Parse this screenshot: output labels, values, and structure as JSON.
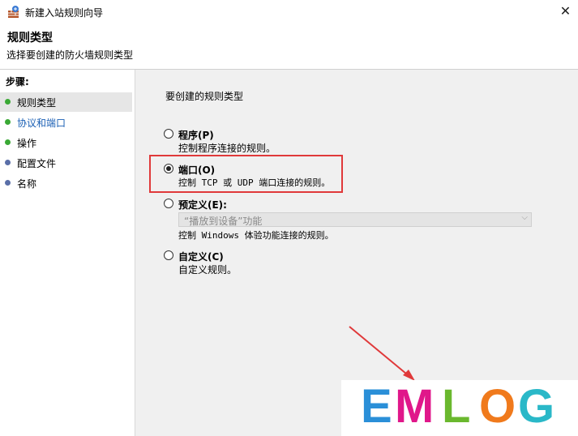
{
  "window": {
    "title": "新建入站规则向导",
    "close_glyph": "✕"
  },
  "header": {
    "title": "规则类型",
    "subtitle": "选择要创建的防火墙规则类型"
  },
  "sidebar": {
    "steps_label": "步骤:",
    "steps": [
      {
        "label": "规则类型",
        "color": "#3aa935",
        "current": true
      },
      {
        "label": "协议和端口",
        "color": "#3aa935",
        "current": false,
        "link_color": "#1a5fb4"
      },
      {
        "label": "操作",
        "color": "#3aa935",
        "current": false
      },
      {
        "label": "配置文件",
        "color": "#5a6fa8",
        "current": false
      },
      {
        "label": "名称",
        "color": "#5a6fa8",
        "current": false
      }
    ]
  },
  "main": {
    "prompt": "要创建的规则类型",
    "options": [
      {
        "label": "程序(P)",
        "desc": "控制程序连接的规则。",
        "checked": false
      },
      {
        "label": "端口(O)",
        "desc": "控制 TCP 或 UDP 端口连接的规则。",
        "checked": true
      },
      {
        "label": "预定义(E):",
        "desc": "控制 Windows 体验功能连接的规则。",
        "checked": false
      },
      {
        "label": "自定义(C)",
        "desc": "自定义规则。",
        "checked": false
      }
    ],
    "predefined_select": {
      "value": "“播放到设备”功能",
      "disabled": true
    }
  },
  "watermark": {
    "letters": [
      "E",
      "M",
      "L",
      "O",
      "G"
    ],
    "colors": [
      "#2a8fd8",
      "#e0178a",
      "#6ab82e",
      "#f07a1c",
      "#2ab8c8"
    ]
  },
  "colors": {
    "annotation_red": "#e0393a"
  }
}
